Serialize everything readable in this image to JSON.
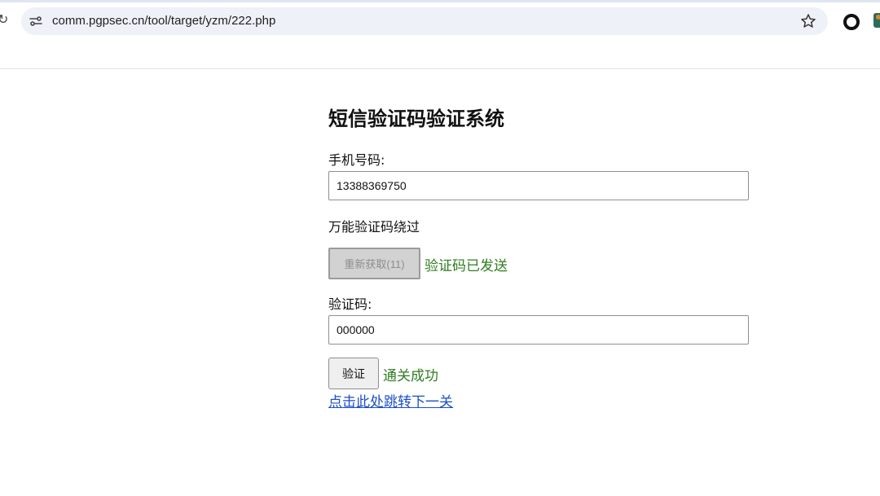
{
  "browser": {
    "url": "comm.pgpsec.cn/tool/target/yzm/222.php",
    "icons": [
      "site-info-icon",
      "bookmark-star-icon",
      "extension-icon"
    ]
  },
  "page": {
    "title": "短信验证码验证系统",
    "phone_label": "手机号码:",
    "phone_value": "13388369750",
    "bypass_text": "万能验证码绕过",
    "resend_button_label": "重新获取(11)",
    "sent_status": "验证码已发送",
    "code_label": "验证码:",
    "code_value": "000000",
    "verify_button_label": "验证",
    "verify_status": "通关成功",
    "next_link": "点击此处跳转下一关"
  },
  "colors": {
    "success_green": "#2f7d1f",
    "link_blue": "#1a4fc7",
    "omnibox_bg": "#eef1f8"
  }
}
